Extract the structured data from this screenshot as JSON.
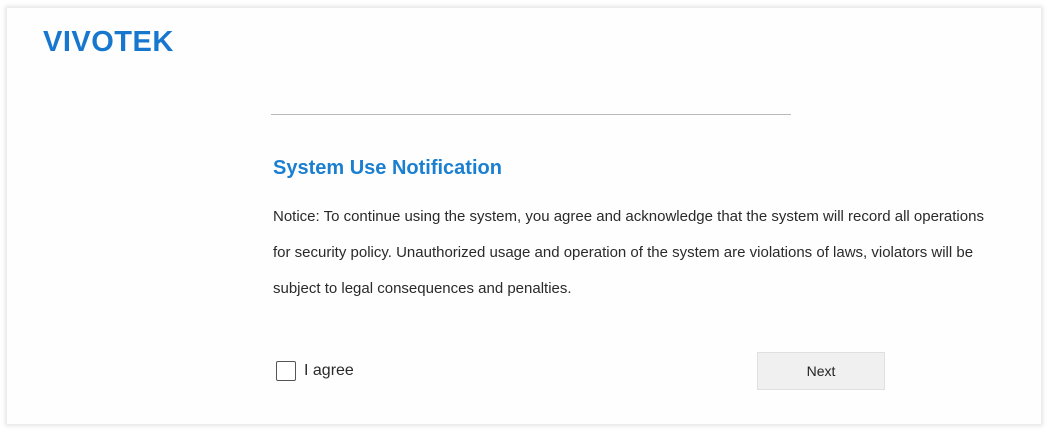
{
  "brand": {
    "logo_text": "VIVOTEK",
    "color": "#1777cf"
  },
  "notification": {
    "title": "System Use Notification",
    "title_color": "#1a7fd0",
    "body": "Notice: To continue using the system, you agree and acknowledge that the system will record all operations for security policy. Unauthorized usage and operation of the system are violations of laws, violators will be subject to legal consequences and penalties."
  },
  "agreement": {
    "checkbox_label": "I agree",
    "checked": false
  },
  "actions": {
    "next_label": "Next"
  }
}
